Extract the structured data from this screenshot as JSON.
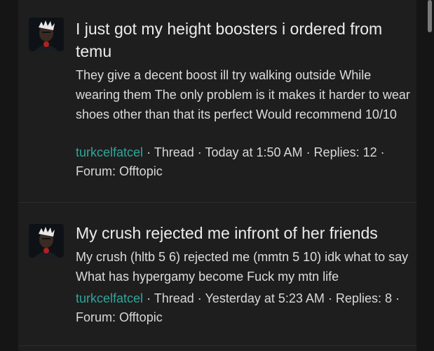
{
  "results": [
    {
      "avatar_icon": "user-avatar-icon",
      "title": "I just got my height boosters i ordered from temu",
      "snippet": "They give a decent boost ill try walking outside While wearing them The only problem is it makes it harder to wear shoes other than that its perfect Would recommend 10/10",
      "author": "turkcelfatcel",
      "meta_type": "· Thread",
      "meta_date": "· Today at 1:50 AM",
      "meta_replies": "· Replies: 12",
      "meta_forum": "· Forum: Offtopic"
    },
    {
      "avatar_icon": "user-avatar-icon",
      "title": "My crush rejected me infront of her friends",
      "snippet": "My crush (hltb 5 6) rejected me (mmtn 5 10) idk what to say What has hypergamy become Fuck my mtn life",
      "author": "turkcelfatcel",
      "meta_type": "· Thread",
      "meta_date": "· Yesterday at 5:23 AM ·",
      "meta_replies": "Replies: 8",
      "meta_forum": "· Forum: Offtopic"
    }
  ],
  "colors": {
    "background": "#151515",
    "panel": "#1e1e1e",
    "username": "#2fa69a"
  }
}
